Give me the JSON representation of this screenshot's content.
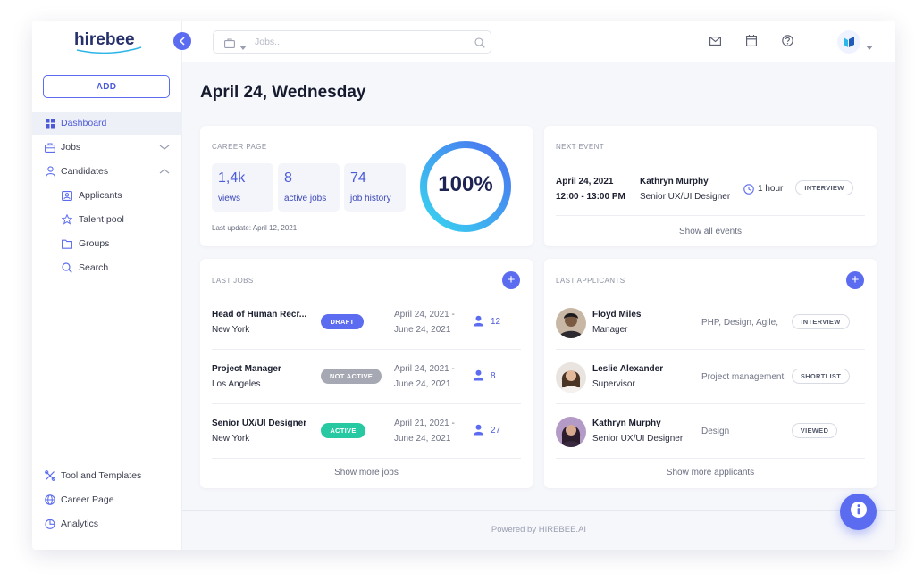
{
  "brand": {
    "logo_text": "hirebee"
  },
  "sidebar": {
    "add_label": "ADD",
    "items": [
      {
        "label": "Dashboard",
        "icon": "dashboard-icon",
        "active": true
      },
      {
        "label": "Jobs",
        "icon": "briefcase-icon"
      },
      {
        "label": "Candidates",
        "icon": "user-icon"
      },
      {
        "label": "Applicants",
        "icon": "id-card-icon"
      },
      {
        "label": "Talent pool",
        "icon": "star-icon"
      },
      {
        "label": "Groups",
        "icon": "folder-icon"
      },
      {
        "label": "Search",
        "icon": "search-icon"
      }
    ],
    "bottom_items": [
      {
        "label": "Tool and Templates",
        "icon": "tools-icon"
      },
      {
        "label": "Career Page",
        "icon": "globe-icon"
      },
      {
        "label": "Analytics",
        "icon": "pie-chart-icon"
      }
    ]
  },
  "topbar": {
    "search_placeholder": "Jobs...",
    "icons": [
      "mail-icon",
      "calendar-icon",
      "help-icon",
      "profile-logo-icon"
    ]
  },
  "page": {
    "title": "April 24, Wednesday"
  },
  "career_page": {
    "title": "CAREER PAGE",
    "stats": [
      {
        "value": "1,4k",
        "caption": "views"
      },
      {
        "value": "8",
        "caption": "active jobs"
      },
      {
        "value": "74",
        "caption": "job history"
      }
    ],
    "last_update": "Last update: April 12, 2021",
    "progress_label": "100%",
    "progress_fraction": 1.0
  },
  "next_event": {
    "title": "NEXT EVENT",
    "date": "April 24, 2021",
    "time": "12:00 - 13:00 PM",
    "person": "Kathryn Murphy",
    "role": "Senior UX/UI Designer",
    "duration": "1 hour",
    "badge": "INTERVIEW",
    "link": "Show all events"
  },
  "last_jobs": {
    "title": "LAST JOBS",
    "rows": [
      {
        "title": "Head of Human Recr...",
        "location": "New York",
        "status": "DRAFT",
        "status_color": "#5b6cf0",
        "date_from": "April 24, 2021 -",
        "date_to": "June 24, 2021",
        "candidates": "12"
      },
      {
        "title": "Project Manager",
        "location": "Los Angeles",
        "status": "NOT ACTIVE",
        "status_color": "#a6a9b3",
        "date_from": "April 24, 2021 -",
        "date_to": "June 24, 2021",
        "candidates": "8"
      },
      {
        "title": "Senior UX/UI Designer",
        "location": "New York",
        "status": "ACTIVE",
        "status_color": "#27c9a2",
        "date_from": "April 21, 2021 -",
        "date_to": "June 24, 2021",
        "candidates": "27"
      }
    ],
    "link": "Show more jobs"
  },
  "last_applicants": {
    "title": "LAST APPLICANTS",
    "rows": [
      {
        "name": "Floyd Miles",
        "role": "Manager",
        "skills": "PHP, Design, Agile,",
        "status": "INTERVIEW"
      },
      {
        "name": "Leslie Alexander",
        "role": "Supervisor",
        "skills": "Project management",
        "status": "SHORTLIST"
      },
      {
        "name": "Kathryn Murphy",
        "role": "Senior UX/UI Designer",
        "skills": "Design",
        "status": "VIEWED"
      }
    ],
    "link": "Show more applicants"
  },
  "footer": {
    "powered": "Powered by HIREBEE.AI"
  },
  "colors": {
    "accent": "#5b6cf0",
    "active_green": "#27c9a2",
    "inactive_gray": "#a6a9b3"
  }
}
